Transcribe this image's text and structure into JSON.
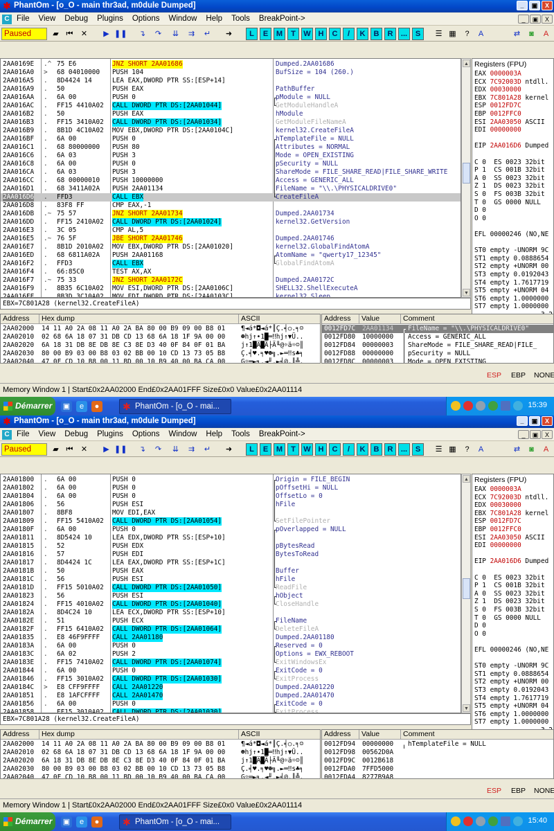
{
  "window_title": "PhantOm - [o_O - main thr3ad, m0dule Dumped]",
  "window_buttons": [
    "_",
    "▣",
    "X"
  ],
  "menu": [
    "File",
    "View",
    "Debug",
    "Plugins",
    "Options",
    "Window",
    "Help",
    "Tools",
    "BreakPoint->"
  ],
  "status_state": "Paused",
  "toolbar_letters": [
    "L",
    "E",
    "M",
    "T",
    "W",
    "H",
    "C",
    "/",
    "K",
    "B",
    "R",
    "...",
    "S"
  ],
  "regs_header": "Registers (FPU)",
  "regs_lines": [
    "EAX 0000003A",
    "ECX 7C92003D ntdll.",
    "EDX 00030000",
    "EBX 7C801A28 kernel",
    "ESP 0012FD7C",
    "EBP 0012FFC0",
    "ESI 2AA03050 ASCII",
    "EDI 00000000",
    "",
    "EIP 2AA016D6 Dumped",
    "",
    "C 0  ES 0023 32bit",
    "P 1  CS 001B 32bit",
    "A 0  SS 0023 32bit",
    "Z 1  DS 0023 32bit",
    "S 0  FS 003B 32bit",
    "T 0  GS 0000 NULL",
    "D 0",
    "O 0",
    "",
    "EFL 00000246 (NO,NE",
    "",
    "ST0 empty -UNORM 9C",
    "ST1 empty 0.0888654",
    "ST2 empty +UNORM 00",
    "ST3 empty 0.0192043",
    "ST4 empty 1.7617719",
    "ST5 empty +UNORM 04",
    "ST6 empty 1.0000000",
    "ST7 empty 1.0000000",
    "                 3 2"
  ],
  "hex_headers": [
    "Address",
    "Hex dump",
    "ASCII"
  ],
  "hex_rows": [
    {
      "addr": "2AA02000",
      "hex": "14 11 A0 2A 08 11 A0 2A BA 80 00 B9 09 00 B8 01",
      "ascii": "¶◄á*◘◄á*║Ç.╡○.╕☺"
    },
    {
      "addr": "2AA02010",
      "hex": "02 68 6A 18 07 31 DB CD 13 68 6A 18 1F 9A 00 00",
      "ascii": "☻hj↑•1█═‼hj↑▼Ü.."
    },
    {
      "addr": "2AA02020",
      "hex": "6A 18 31 DB 8E DB 8E C3 8E D3 40 0F 84 0F 01 BA",
      "ascii": "j↑1█Ä█Ä├Ä╙@☼ä☼☺║"
    },
    {
      "addr": "2AA02030",
      "hex": "80 00 B9 03 00 B8 03 02 BB 00 10 CD 13 73 05 B8",
      "ascii": "Ç.╡♥.╕♥☻╗.►═‼s♣╕"
    },
    {
      "addr": "2AA02040",
      "hex": "47 0F CD 10 B8 00 11 BD 00 10 B9 40 00 BA CA 00",
      "ascii": "G☼═►╕.◄╜.►╡@.║╩."
    }
  ],
  "stack_headers": [
    "Address",
    "Value",
    "Comment"
  ],
  "espbar": [
    "ESP",
    "EBP",
    "NONE"
  ],
  "top": {
    "cpu_rows": [
      {
        "addr": "2AA0169E",
        "mark": ".^",
        "hex": "75 E6",
        "asm": "JNZ SHORT 2AA01686",
        "asm_hl": "yel",
        "cmt": "Dumped.2AA01686"
      },
      {
        "addr": "2AA016A0",
        "mark": ">",
        "hex": "68 04010000",
        "asm": "PUSH 104",
        "cmt": "BufSize = 104 (260.)"
      },
      {
        "addr": "2AA016A5",
        "mark": ".",
        "hex": "8D4424 14",
        "asm": "LEA EAX,DWORD PTR SS:[ESP+14]",
        "cmt": ""
      },
      {
        "addr": "2AA016A9",
        "mark": ".",
        "hex": "50",
        "asm": "PUSH EAX",
        "cmt": "PathBuffer"
      },
      {
        "addr": "2AA016AA",
        "mark": ".",
        "hex": "6A 00",
        "asm": "PUSH 0",
        "cmt": "pModule = NULL",
        "cmt_br": "top"
      },
      {
        "addr": "2AA016AC",
        "mark": ".",
        "hex": "FF15 4410A02",
        "asm": "CALL DWORD PTR DS:[2AA01044]",
        "asm_hl": "cyan",
        "cmt": "GetModuleHandleA",
        "cmt_br": "bot",
        "cmt_gray": true
      },
      {
        "addr": "2AA016B2",
        "mark": ".",
        "hex": "50",
        "asm": "PUSH EAX",
        "cmt": "hModule"
      },
      {
        "addr": "2AA016B3",
        "mark": ".",
        "hex": "FF15 3410A02",
        "asm": "CALL DWORD PTR DS:[2AA01034]",
        "asm_hl": "cyan",
        "cmt": "GetModuleFileNameA",
        "cmt_gray": true
      },
      {
        "addr": "2AA016B9",
        "mark": ".",
        "hex": "8B1D 4C10A02",
        "asm": "MOV EBX,DWORD PTR DS:[2AA0104C]",
        "cmt": "kernel32.CreateFileA"
      },
      {
        "addr": "2AA016BF",
        "mark": ".",
        "hex": "6A 00",
        "asm": "PUSH 0",
        "cmt": "hTemplateFile = NULL",
        "cmt_br": "top"
      },
      {
        "addr": "2AA016C1",
        "mark": ".",
        "hex": "68 80000000",
        "asm": "PUSH 80",
        "cmt": "Attributes = NORMAL",
        "cmt_br": "mid"
      },
      {
        "addr": "2AA016C6",
        "mark": ".",
        "hex": "6A 03",
        "asm": "PUSH 3",
        "cmt": "Mode = OPEN_EXISTING",
        "cmt_br": "mid"
      },
      {
        "addr": "2AA016C8",
        "mark": ".",
        "hex": "6A 00",
        "asm": "PUSH 0",
        "cmt": "pSecurity = NULL",
        "cmt_br": "mid"
      },
      {
        "addr": "2AA016CA",
        "mark": ".",
        "hex": "6A 03",
        "asm": "PUSH 3",
        "cmt": "ShareMode = FILE_SHARE_READ|FILE_SHARE_WRITE",
        "cmt_br": "mid"
      },
      {
        "addr": "2AA016CC",
        "mark": ".",
        "hex": "68 00000010",
        "asm": "PUSH 10000000",
        "cmt": "Access = GENERIC_ALL",
        "cmt_br": "mid"
      },
      {
        "addr": "2AA016D1",
        "mark": ".",
        "hex": "68 3411A02A",
        "asm": "PUSH 2AA01134",
        "cmt": "FileName = \"\\\\.\\PHYSICALDRIVE0\"",
        "cmt_br": "mid"
      },
      {
        "addr": "2AA016D6",
        "mark": ".",
        "hex": "FFD3",
        "asm": "CALL EBX",
        "asm_hl": "cyan",
        "cmt": "CreateFileA",
        "cmt_br": "bot",
        "sel": true
      },
      {
        "addr": "2AA016D8",
        "mark": ".",
        "hex": "83F8 FF",
        "asm": "CMP EAX,-1",
        "cmt": ""
      },
      {
        "addr": "2AA016DB",
        "mark": ".~",
        "hex": "75 57",
        "asm": "JNZ SHORT 2AA01734",
        "asm_hl": "yel",
        "cmt": "Dumped.2AA01734"
      },
      {
        "addr": "2AA016DD",
        "mark": ".",
        "hex": "FF15 2410A02",
        "asm": "CALL DWORD PTR DS:[2AA01024]",
        "asm_hl": "cyan",
        "cmt": "kernel32.GetVersion"
      },
      {
        "addr": "2AA016E3",
        "mark": ".",
        "hex": "3C 05",
        "asm": "CMP AL,5",
        "cmt": ""
      },
      {
        "addr": "2AA016E5",
        "mark": ".~",
        "hex": "76 5F",
        "asm": "JBE SHORT 2AA01746",
        "asm_hl": "yel",
        "cmt": "Dumped.2AA01746"
      },
      {
        "addr": "2AA016E7",
        "mark": ".",
        "hex": "8B1D 2010A02",
        "asm": "MOV EBX,DWORD PTR DS:[2AA01020]",
        "cmt": "kernel32.GlobalFindAtomA"
      },
      {
        "addr": "2AA016ED",
        "mark": ".",
        "hex": "68 6811A02A",
        "asm": "PUSH 2AA01168",
        "cmt": "AtomName = \"qwerty17_12345\"",
        "cmt_br": "top"
      },
      {
        "addr": "2AA016F2",
        "mark": ".",
        "hex": "FFD3",
        "asm": "CALL EBX",
        "asm_hl": "cyan",
        "cmt": "GlobalFindAtomA",
        "cmt_br": "bot",
        "cmt_gray": true
      },
      {
        "addr": "2AA016F4",
        "mark": ".",
        "hex": "66:85C0",
        "asm": "TEST AX,AX",
        "cmt": ""
      },
      {
        "addr": "2AA016F7",
        "mark": ".~",
        "hex": "75 33",
        "asm": "JNZ SHORT 2AA0172C",
        "asm_hl": "yel",
        "cmt": "Dumped.2AA0172C"
      },
      {
        "addr": "2AA016F9",
        "mark": ".",
        "hex": "8B35 6C10A02",
        "asm": "MOV ESI,DWORD PTR DS:[2AA0106C]",
        "cmt": "SHELL32.ShellExecuteA"
      },
      {
        "addr": "2AA016FF",
        "mark": ".",
        "hex": "8B3D 3C10A02",
        "asm": "MOV EDI,DWORD PTR DS:[2AA0103C]",
        "cmt": "kernel32.Sleep"
      }
    ],
    "info_line": "EBX=7C801A28 (kernel32.CreateFileA)",
    "stack_rows": [
      {
        "addr": "0012FD7C",
        "val": "2AA01134",
        "cmt": "FileName = \"\\\\.\\PHYSICALDRIVE0\"",
        "sel": true,
        "br": "top"
      },
      {
        "addr": "0012FD80",
        "val": "10000000",
        "cmt": "Access = GENERIC_ALL",
        "br": "mid"
      },
      {
        "addr": "0012FD84",
        "val": "00000003",
        "cmt": "ShareMode = FILE_SHARE_READ|FILE_",
        "br": "mid"
      },
      {
        "addr": "0012FD88",
        "val": "00000000",
        "cmt": "pSecurity = NULL",
        "br": "mid"
      },
      {
        "addr": "0012FD8C",
        "val": "00000003",
        "cmt": "Mode = OPEN_EXISTING",
        "br": "mid"
      }
    ],
    "statusbar": "Memory Window 1 | Start£0x2AA02000  End£0x2AA01FFF  Size£0x0 Value£0x2AA01114",
    "task_label": "PhantOm - [o_O - mai...",
    "start_label": "Démarrer",
    "clock": "15:39"
  },
  "bot": {
    "cpu_rows": [
      {
        "addr": "2AA01800",
        "mark": ".",
        "hex": "6A 00",
        "asm": "PUSH 0",
        "cmt": "Origin = FILE_BEGIN",
        "cmt_br": "top"
      },
      {
        "addr": "2AA01802",
        "mark": ".",
        "hex": "6A 00",
        "asm": "PUSH 0",
        "cmt": "pOffsetHi = NULL",
        "cmt_br": "mid"
      },
      {
        "addr": "2AA01804",
        "mark": ".",
        "hex": "6A 00",
        "asm": "PUSH 0",
        "cmt": "OffsetLo = 0",
        "cmt_br": "mid"
      },
      {
        "addr": "2AA01806",
        "mark": ".",
        "hex": "56",
        "asm": "PUSH ESI",
        "cmt": "hFile",
        "cmt_br": "mid"
      },
      {
        "addr": "2AA01807",
        "mark": ".",
        "hex": "8BF8",
        "asm": "MOV EDI,EAX",
        "cmt": "",
        "cmt_br": "mid"
      },
      {
        "addr": "2AA01809",
        "mark": ".",
        "hex": "FF15 5410A02",
        "asm": "CALL DWORD PTR DS:[2AA01054]",
        "asm_hl": "cyan",
        "cmt": "SetFilePointer",
        "cmt_br": "bot",
        "cmt_gray": true
      },
      {
        "addr": "2AA0180F",
        "mark": ".",
        "hex": "6A 00",
        "asm": "PUSH 0",
        "cmt": "pOverlapped = NULL",
        "cmt_br": "top"
      },
      {
        "addr": "2AA01811",
        "mark": ".",
        "hex": "8D5424 10",
        "asm": "LEA EDX,DWORD PTR SS:[ESP+10]",
        "cmt": "",
        "cmt_br": "mid"
      },
      {
        "addr": "2AA01815",
        "mark": ".",
        "hex": "52",
        "asm": "PUSH EDX",
        "cmt": "pBytesRead",
        "cmt_br": "mid"
      },
      {
        "addr": "2AA01816",
        "mark": ".",
        "hex": "57",
        "asm": "PUSH EDI",
        "cmt": "BytesToRead",
        "cmt_br": "mid"
      },
      {
        "addr": "2AA01817",
        "mark": ".",
        "hex": "8D4424 1C",
        "asm": "LEA EAX,DWORD PTR SS:[ESP+1C]",
        "cmt": "",
        "cmt_br": "mid"
      },
      {
        "addr": "2AA0181B",
        "mark": ".",
        "hex": "50",
        "asm": "PUSH EAX",
        "cmt": "Buffer",
        "cmt_br": "mid"
      },
      {
        "addr": "2AA0181C",
        "mark": ".",
        "hex": "56",
        "asm": "PUSH ESI",
        "cmt": "hFile",
        "cmt_br": "mid"
      },
      {
        "addr": "2AA0181D",
        "mark": ".",
        "hex": "FF15 5010A02",
        "asm": "CALL DWORD PTR DS:[2AA01050]",
        "asm_hl": "cyan",
        "cmt": "ReadFile",
        "cmt_br": "bot",
        "cmt_gray": true
      },
      {
        "addr": "2AA01823",
        "mark": ".",
        "hex": "56",
        "asm": "PUSH ESI",
        "cmt": "hObject",
        "cmt_br": "top"
      },
      {
        "addr": "2AA01824",
        "mark": ".",
        "hex": "FF15 4010A02",
        "asm": "CALL DWORD PTR DS:[2AA01040]",
        "asm_hl": "cyan",
        "cmt": "CloseHandle",
        "cmt_br": "bot",
        "cmt_gray": true
      },
      {
        "addr": "2AA0182A",
        "mark": ".",
        "hex": "8D4C24 10",
        "asm": "LEA ECX,DWORD PTR SS:[ESP+10]",
        "cmt": ""
      },
      {
        "addr": "2AA0182E",
        "mark": ".",
        "hex": "51",
        "asm": "PUSH ECX",
        "cmt": "FileName",
        "cmt_br": "top"
      },
      {
        "addr": "2AA0182F",
        "mark": ".",
        "hex": "FF15 6410A02",
        "asm": "CALL DWORD PTR DS:[2AA01064]",
        "asm_hl": "cyan",
        "cmt": "DeleteFileA",
        "cmt_br": "bot",
        "cmt_gray": true
      },
      {
        "addr": "2AA01835",
        "mark": ".",
        "hex": "E8 46F9FFFF",
        "asm": "CALL 2AA01180",
        "asm_hl": "cyan",
        "cmt": "Dumped.2AA01180"
      },
      {
        "addr": "2AA0183A",
        "mark": ".",
        "hex": "6A 00",
        "asm": "PUSH 0",
        "cmt": "Reserved = 0",
        "cmt_br": "top"
      },
      {
        "addr": "2AA0183C",
        "mark": ".",
        "hex": "6A 02",
        "asm": "PUSH 2",
        "cmt": "Options = EWX_REBOOT",
        "cmt_br": "mid"
      },
      {
        "addr": "2AA0183E",
        "mark": ".",
        "hex": "FF15 7410A02",
        "asm": "CALL DWORD PTR DS:[2AA01074]",
        "asm_hl": "cyan",
        "cmt": "ExitWindowsEx",
        "cmt_br": "bot",
        "cmt_gray": true
      },
      {
        "addr": "2AA01844",
        "mark": ".",
        "hex": "6A 00",
        "asm": "PUSH 0",
        "cmt": "ExitCode = 0",
        "cmt_br": "top"
      },
      {
        "addr": "2AA01846",
        "mark": ".",
        "hex": "FF15 3010A02",
        "asm": "CALL DWORD PTR DS:[2AA01030]",
        "asm_hl": "cyan",
        "cmt": "ExitProcess",
        "cmt_br": "bot",
        "cmt_gray": true
      },
      {
        "addr": "2AA0184C",
        "mark": ">",
        "hex": "E8 CFF9FFFF",
        "asm": "CALL 2AA01220",
        "asm_hl": "cyan",
        "cmt": "Dumped.2AA01220"
      },
      {
        "addr": "2AA01851",
        "mark": ".",
        "hex": "E8 1AFCFFFF",
        "asm": "CALL 2AA01470",
        "asm_hl": "cyan",
        "cmt": "Dumped.2AA01470"
      },
      {
        "addr": "2AA01856",
        "mark": ".",
        "hex": "6A 00",
        "asm": "PUSH 0",
        "cmt": "ExitCode = 0",
        "cmt_br": "top"
      },
      {
        "addr": "2AA01858",
        "mark": ".",
        "hex": "FF15 3010A02",
        "asm": "CALL DWORD PTR DS:[2AA01030]",
        "asm_hl": "cyan",
        "cmt": "ExitProcess",
        "cmt_br": "bot",
        "cmt_gray": true
      }
    ],
    "info_line": "EBX=7C801A28 (kernel32.CreateFileA)",
    "stack_rows": [
      {
        "addr": "0012FD94",
        "val": "00000000",
        "cmt": "hTemplateFile = NULL",
        "br": "top"
      },
      {
        "addr": "0012FD98",
        "val": "00562D0A",
        "cmt": ""
      },
      {
        "addr": "0012FD9C",
        "val": "0012B618",
        "cmt": ""
      },
      {
        "addr": "0012FDA0",
        "val": "7FFD5000",
        "cmt": ""
      },
      {
        "addr": "0012FDA4",
        "val": "8277B9A8",
        "cmt": ""
      }
    ],
    "statusbar": "Memory Window 1 | Start£0x2AA02000  End£0x2AA01FFF  Size£0x0 Value£0x2AA01114",
    "task_label": "PhantOm - [o_O - mai...",
    "start_label": "Démarrer",
    "clock": "15:40"
  }
}
